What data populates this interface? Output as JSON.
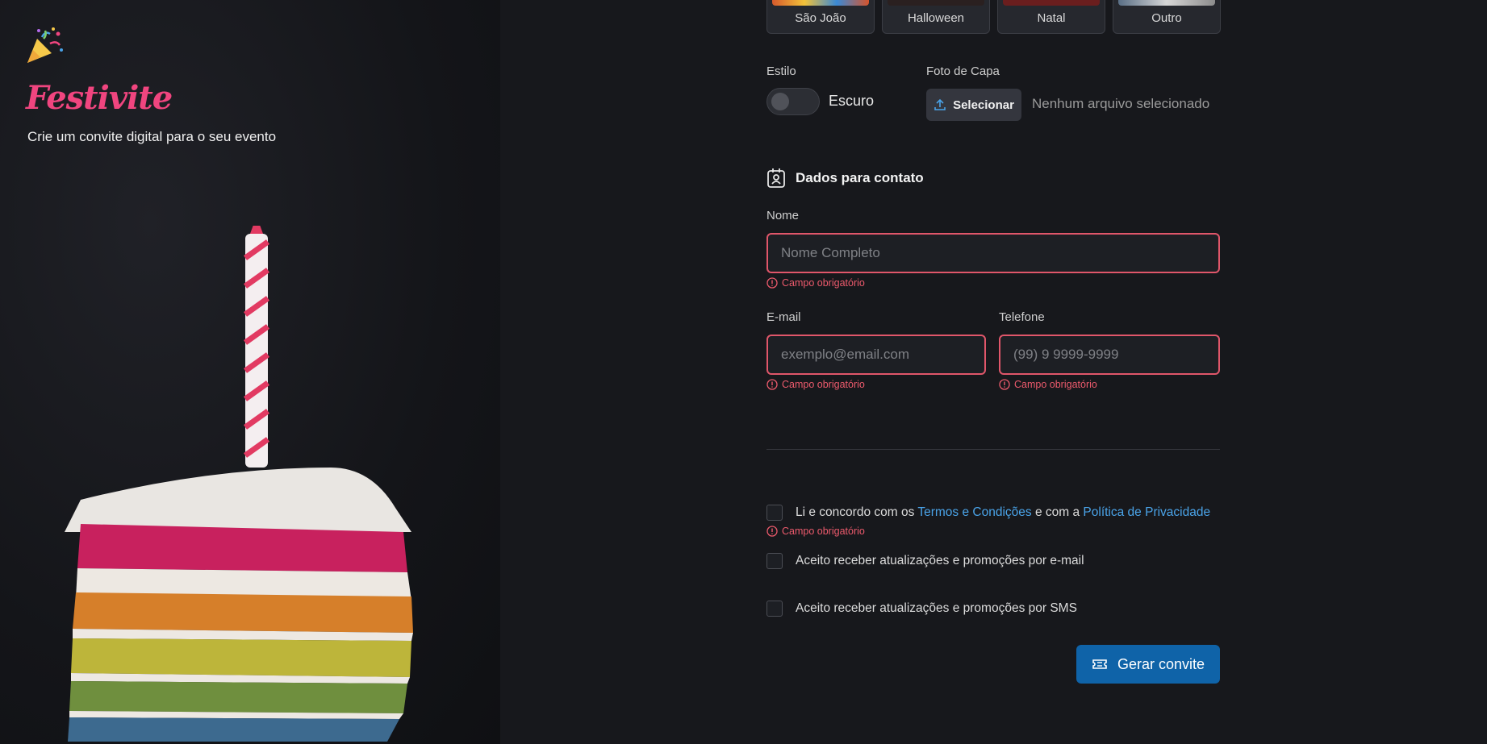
{
  "hero": {
    "brand": "Festivite",
    "tagline": "Crie um convite digital para o seu evento"
  },
  "themes": [
    {
      "label": "São João",
      "color": "#d65a2c"
    },
    {
      "label": "Halloween",
      "color": "#2a2020"
    },
    {
      "label": "Natal",
      "color": "#6a1e1e"
    },
    {
      "label": "Outro",
      "color": "#8c8c8c"
    }
  ],
  "style": {
    "label": "Estilo",
    "toggle_label": "Escuro"
  },
  "cover": {
    "label": "Foto de Capa",
    "button_label": "Selecionar",
    "status": "Nenhum arquivo selecionado"
  },
  "contact": {
    "title": "Dados para contato",
    "name_label": "Nome",
    "name_placeholder": "Nome Completo",
    "email_label": "E-mail",
    "email_placeholder": "exemplo@email.com",
    "phone_label": "Telefone",
    "phone_placeholder": "(99) 9 9999-9999",
    "required_error": "Campo obrigatório"
  },
  "consent": {
    "terms_prefix": "Li e concordo com os",
    "terms_link": "Termos e Condições",
    "terms_middle": "e com a",
    "privacy_link": "Política de Privacidade",
    "email_optin": "Aceito receber atualizações e promoções por e-mail",
    "sms_optin": "Aceito receber atualizações e promoções por SMS"
  },
  "submit_label": "Gerar convite",
  "colors": {
    "accent_pink": "#f0457f",
    "error": "#e0566a",
    "primary": "#0f63a8",
    "link": "#4aa3e8"
  }
}
